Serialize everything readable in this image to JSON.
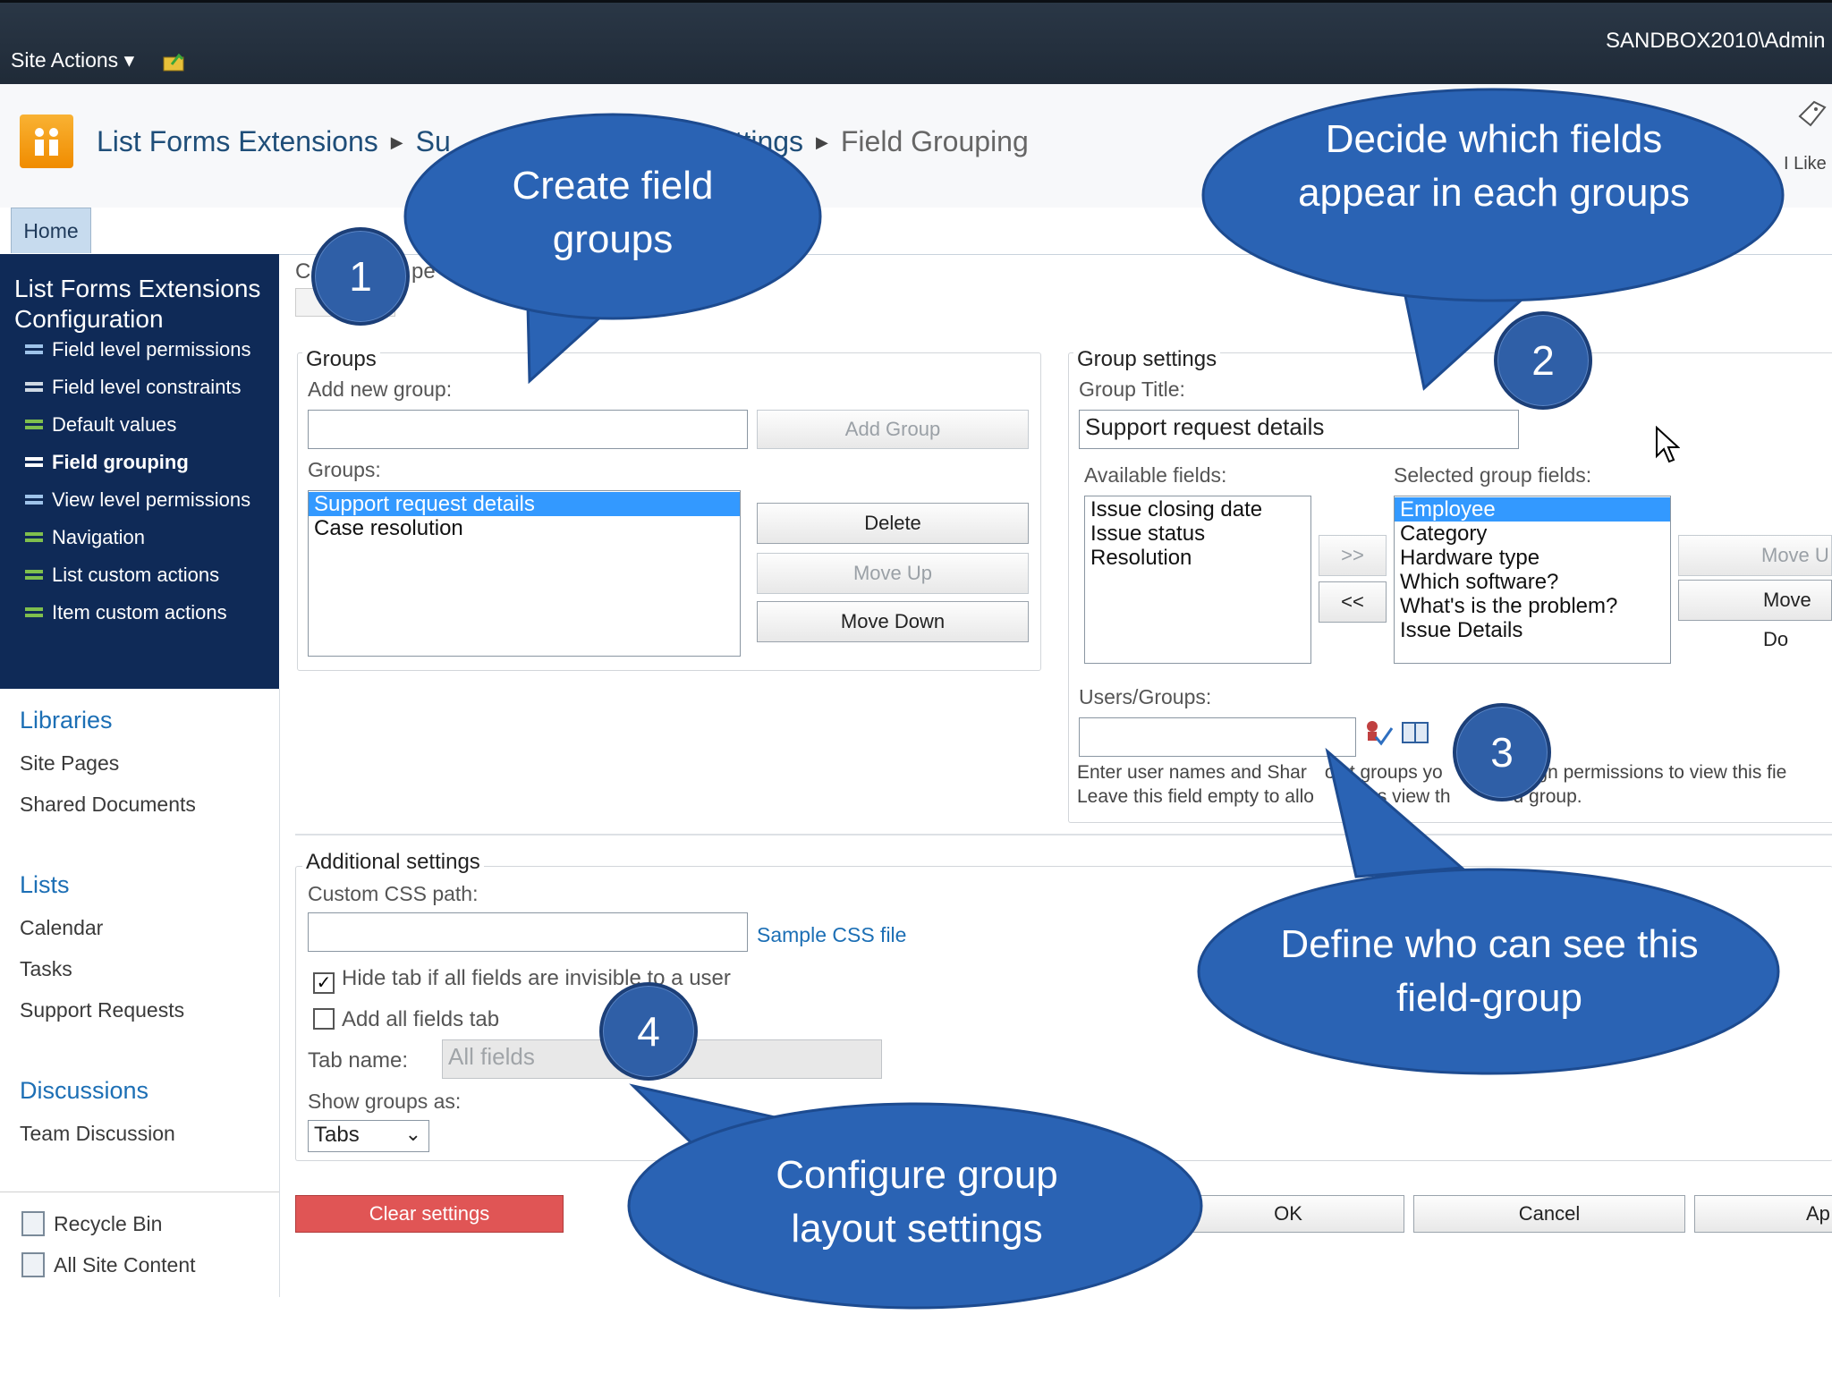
{
  "topbar": {
    "site_actions": "Site Actions ▾",
    "user": "SANDBOX2010\\Admin"
  },
  "breadcrumb": {
    "site": "List Forms Extensions",
    "part2": "Su",
    "part3": "ettings",
    "current": "Field Grouping"
  },
  "like": "I Like",
  "home_tab": "Home",
  "config": {
    "title": "List Forms Extensions Configuration",
    "items": [
      {
        "label": "Field level permissions",
        "bold": false
      },
      {
        "label": "Field level constraints",
        "bold": false
      },
      {
        "label": "Default values",
        "bold": false
      },
      {
        "label": "Field grouping",
        "bold": true
      },
      {
        "label": "View level permissions",
        "bold": false
      },
      {
        "label": "Navigation",
        "bold": false
      },
      {
        "label": "List custom actions",
        "bold": false
      },
      {
        "label": "Item custom actions",
        "bold": false
      }
    ]
  },
  "quicklaunch": {
    "libraries": "Libraries",
    "site_pages": "Site Pages",
    "shared_documents": "Shared Documents",
    "lists": "Lists",
    "calendar": "Calendar",
    "tasks": "Tasks",
    "support_requests": "Support Requests",
    "discussions": "Discussions",
    "team_discussion": "Team Discussion",
    "recycle_bin": "Recycle Bin",
    "all_site_content": "All Site Content"
  },
  "top_partial": {
    "c": "C",
    "pe": "pe"
  },
  "groups": {
    "legend": "Groups",
    "add_new_label": "Add new group:",
    "add_new_value": "",
    "add_button": "Add Group",
    "list_label": "Groups:",
    "list": [
      "Support request details",
      "Case resolution"
    ],
    "selected_index": 0,
    "delete_button": "Delete",
    "move_up_button": "Move Up",
    "move_down_button": "Move Down"
  },
  "group_settings": {
    "legend": "Group settings",
    "title_label": "Group Title:",
    "title_value": "Support request details",
    "available_label": "Available fields:",
    "available": [
      "Issue closing date",
      "Issue status",
      "Resolution"
    ],
    "selected_label": "Selected group fields:",
    "selected": [
      "Employee",
      "Category",
      "Hardware type",
      "Which software?",
      "What's is the problem?",
      "Issue Details"
    ],
    "selected_index": 0,
    "add_arrow": ">>",
    "remove_arrow": "<<",
    "move_up": "Move U",
    "move_down": "Move Do",
    "users_label": "Users/Groups:",
    "users_value": "",
    "help_line1": "Enter user names and Shar",
    "help_line1b": "oint groups yo",
    "help_line1c": "ssign permissions to view this fie",
    "help_line2": "Leave this field empty to allo",
    "help_line2b": "users view th",
    "help_line2c": "d group."
  },
  "additional": {
    "legend": "Additional settings",
    "css_label": "Custom CSS path:",
    "css_value": "",
    "sample_link": "Sample CSS file",
    "hide_tab_label": "Hide tab if all fields are invisible to a user",
    "hide_tab_checked": true,
    "add_all_label": "Add all fields tab",
    "add_all_checked": false,
    "tab_name_label": "Tab name:",
    "tab_name_placeholder": "All fields",
    "show_as_label": "Show groups as:",
    "show_as_value": "Tabs"
  },
  "actions": {
    "clear": "Clear settings",
    "ok": "OK",
    "cancel": "Cancel",
    "apply": "Ap"
  },
  "callouts": [
    {
      "number": "1",
      "text": "Create field groups"
    },
    {
      "number": "2",
      "text": "Decide which fields appear in each groups"
    },
    {
      "number": "3",
      "text": "Define who can see this field-group"
    },
    {
      "number": "4",
      "text": "Configure group layout settings"
    }
  ],
  "colors": {
    "callout_fill": "#2a63b4",
    "clear_button": "#e05555",
    "nav_bg": "#0f2a57",
    "selection": "#3399ff"
  }
}
